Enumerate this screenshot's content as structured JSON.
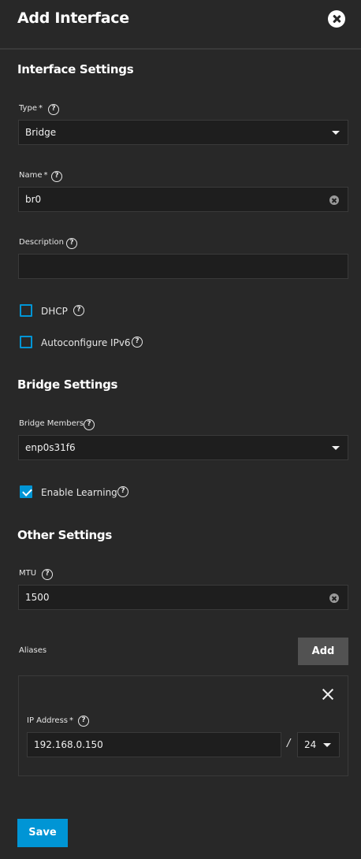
{
  "header": {
    "title": "Add Interface",
    "close_icon": "close-circle-icon"
  },
  "interface_settings": {
    "title": "Interface Settings",
    "type": {
      "label": "Type",
      "required": "*",
      "value": "Bridge"
    },
    "name": {
      "label": "Name",
      "required": "*",
      "value": "br0"
    },
    "description": {
      "label": "Description",
      "value": ""
    },
    "dhcp": {
      "label": "DHCP",
      "checked": false
    },
    "autoconfigure_ipv6": {
      "label": "Autoconfigure IPv6",
      "checked": false
    }
  },
  "bridge_settings": {
    "title": "Bridge Settings",
    "bridge_members": {
      "label": "Bridge Members",
      "value": "enp0s31f6"
    },
    "enable_learning": {
      "label": "Enable Learning",
      "checked": true
    }
  },
  "other_settings": {
    "title": "Other Settings",
    "mtu": {
      "label": "MTU",
      "value": "1500"
    }
  },
  "aliases": {
    "label": "Aliases",
    "add_label": "Add",
    "items": [
      {
        "ip_label": "IP Address",
        "required": "*",
        "ip_value": "192.168.0.150",
        "separator": "/",
        "netmask": "24"
      }
    ]
  },
  "help_glyph": "?",
  "footer": {
    "save_label": "Save"
  },
  "colors": {
    "accent": "#0095d5",
    "background": "#282828",
    "field_bg": "#1e1e1e",
    "add_button": "#525252"
  }
}
